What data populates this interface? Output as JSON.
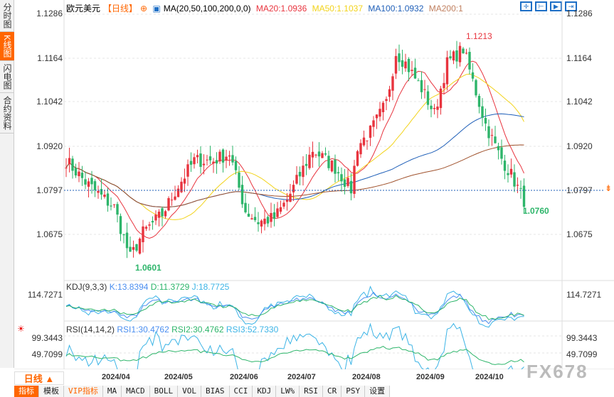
{
  "sidebar": [
    "分时图",
    "K线图",
    "闪电图",
    "合约资料"
  ],
  "legend": {
    "symbol": "欧元美元",
    "period": "【日线】",
    "ma": "MA(20,50,100,200,0,0)",
    "ma20": "MA20:1.0936",
    "ma50": "MA50:1.1037",
    "ma100": "MA100:1.0932",
    "ma200": "MA200:1"
  },
  "price_axis": [
    "1.1286",
    "1.1164",
    "1.1042",
    "1.0920",
    "1.0797",
    "1.0675"
  ],
  "current_price": "1.0797",
  "high_label": "1.1213",
  "low_label": "1.0601",
  "last_low_label": "1.0760",
  "kdj": {
    "title": "KDJ(9,3,3)",
    "k": "K:13.8394",
    "d": "D:11.3729",
    "j": "J:18.7725",
    "axis": "114.7271"
  },
  "rsi": {
    "title": "RSI(14,14,2)",
    "r1": "RSI1:30.4762",
    "r2": "RSI2:30.4762",
    "r3": "RSI3:52.7330",
    "axis1": "99.3443",
    "axis2": "49.7099"
  },
  "period_button": "日线 ▲",
  "dates": [
    "2024/04",
    "2024/05",
    "2024/06",
    "2024/07",
    "2024/08",
    "2024/09",
    "2024/10"
  ],
  "bottom_tabs": [
    "指标",
    "模板",
    "VIP指标",
    "MA",
    "MACD",
    "BOLL",
    "VOL",
    "BIAS",
    "CCI",
    "KDJ",
    "LW%",
    "RSI",
    "CR",
    "PSY",
    "设置"
  ],
  "watermark": "FX678",
  "colors": {
    "up": "#e8343e",
    "down": "#2db56a",
    "ma20": "#e8343e",
    "ma50": "#f2d31b",
    "ma100": "#1f5fb8",
    "ma200": "#a0522d",
    "accent": "#ff6600"
  },
  "price_path": [
    [
      0,
      1.088
    ],
    [
      6,
      1.082
    ],
    [
      11,
      1.078
    ],
    [
      15,
      1.075
    ],
    [
      20,
      1.061
    ],
    [
      24,
      1.068
    ],
    [
      30,
      1.073
    ],
    [
      35,
      1.081
    ],
    [
      40,
      1.088
    ],
    [
      46,
      1.088
    ],
    [
      51,
      1.09
    ],
    [
      56,
      1.074
    ],
    [
      60,
      1.071
    ],
    [
      65,
      1.072
    ],
    [
      69,
      1.077
    ],
    [
      73,
      1.084
    ],
    [
      77,
      1.091
    ],
    [
      84,
      1.086
    ],
    [
      89,
      1.08
    ],
    [
      91,
      1.092
    ],
    [
      95,
      1.096
    ],
    [
      100,
      1.104
    ],
    [
      103,
      1.118
    ],
    [
      106,
      1.115
    ],
    [
      111,
      1.108
    ],
    [
      115,
      1.101
    ],
    [
      119,
      1.115
    ],
    [
      124,
      1.119
    ],
    [
      127,
      1.11
    ],
    [
      131,
      1.098
    ],
    [
      135,
      1.09
    ],
    [
      139,
      1.084
    ],
    [
      143,
      1.077
    ]
  ]
}
